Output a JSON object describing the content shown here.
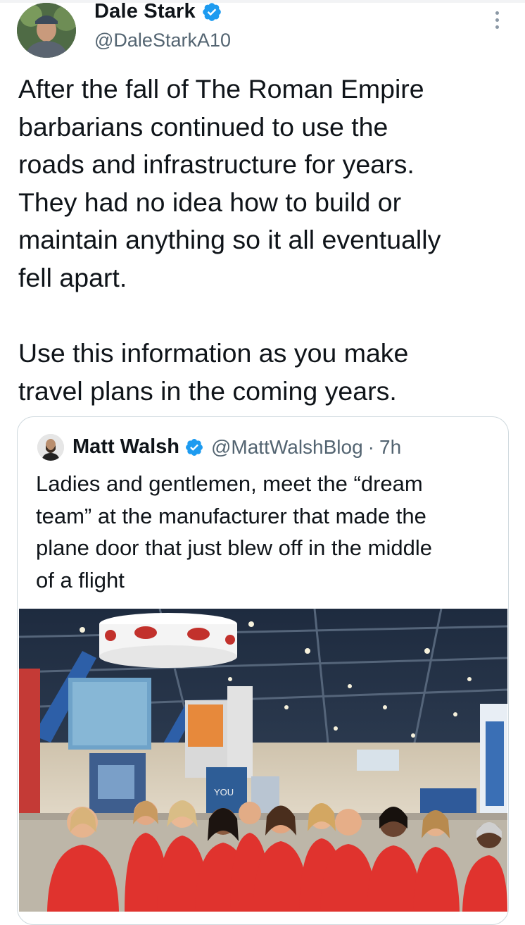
{
  "tweet": {
    "author_name": "Dale Stark",
    "author_handle": "@DaleStarkA10",
    "text": "After the fall of The Roman Empire\nbarbarians continued to use the\nroads and infrastructure for years.\nThey had no idea how to build or\nmaintain anything so it all eventually\nfell apart.\n\nUse this information as you make\ntravel plans in the coming years."
  },
  "quoted_tweet": {
    "author_name": "Matt Walsh",
    "author_handle": "@MattWalshBlog",
    "separator": "·",
    "time": "7h",
    "text": "Ladies and gentlemen, meet the “dream\nteam” at the manufacturer that made the\nplane door that just blew off in the middle\nof a flight",
    "media": {
      "sign_text": "YOU"
    }
  },
  "colors": {
    "verified": "#1d9bf0",
    "text": "#0f1419",
    "secondary_text": "#536471",
    "border": "#cfd9de",
    "shirt_red": "#e0332e"
  },
  "icons": [
    "verified-badge-icon",
    "more-options-icon"
  ]
}
